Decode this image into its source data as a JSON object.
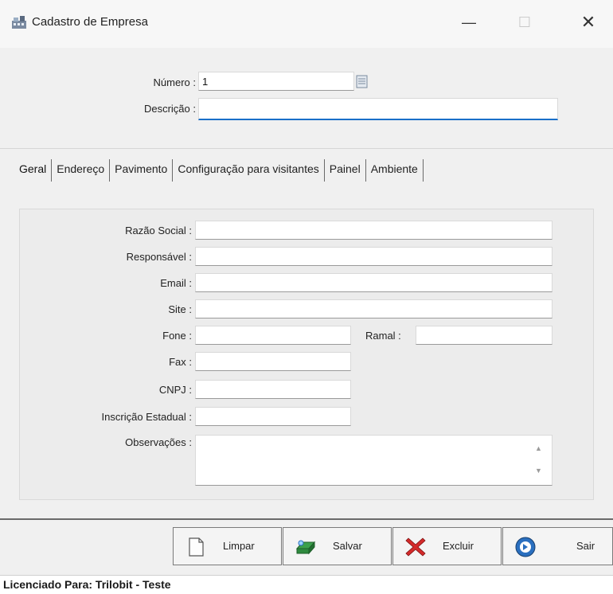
{
  "window": {
    "title": "Cadastro de Empresa",
    "min_glyph": "—",
    "max_glyph": "☐",
    "close_glyph": "✕"
  },
  "header": {
    "numero_label": "Número :",
    "numero_value": "1",
    "descricao_label": "Descrição :",
    "descricao_value": ""
  },
  "tabs": [
    {
      "label": "Geral"
    },
    {
      "label": "Endereço"
    },
    {
      "label": "Pavimento"
    },
    {
      "label": "Configuração para visitantes"
    },
    {
      "label": "Painel"
    },
    {
      "label": "Ambiente"
    }
  ],
  "geral": {
    "razao_social_label": "Razão Social :",
    "razao_social_value": "",
    "responsavel_label": "Responsável :",
    "responsavel_value": "",
    "email_label": "Email :",
    "email_value": "",
    "site_label": "Site :",
    "site_value": "",
    "fone_label": "Fone :",
    "fone_value": "",
    "ramal_label": "Ramal :",
    "ramal_value": "",
    "fax_label": "Fax :",
    "fax_value": "",
    "cnpj_label": "CNPJ :",
    "cnpj_value": "",
    "inscricao_label": "Inscrição Estadual :",
    "inscricao_value": "",
    "observacoes_label": "Observações :",
    "observacoes_value": ""
  },
  "buttons": {
    "limpar": "Limpar",
    "salvar": "Salvar",
    "excluir": "Excluir",
    "sair": "Sair"
  },
  "status": {
    "text": "Licenciado Para: Trilobit - Teste"
  },
  "colors": {
    "focus_underline": "#1a6fc9",
    "excluir_icon": "#d42a2a",
    "salvar_icon": "#2f8a3e",
    "sair_icon": "#2a6fbf"
  }
}
